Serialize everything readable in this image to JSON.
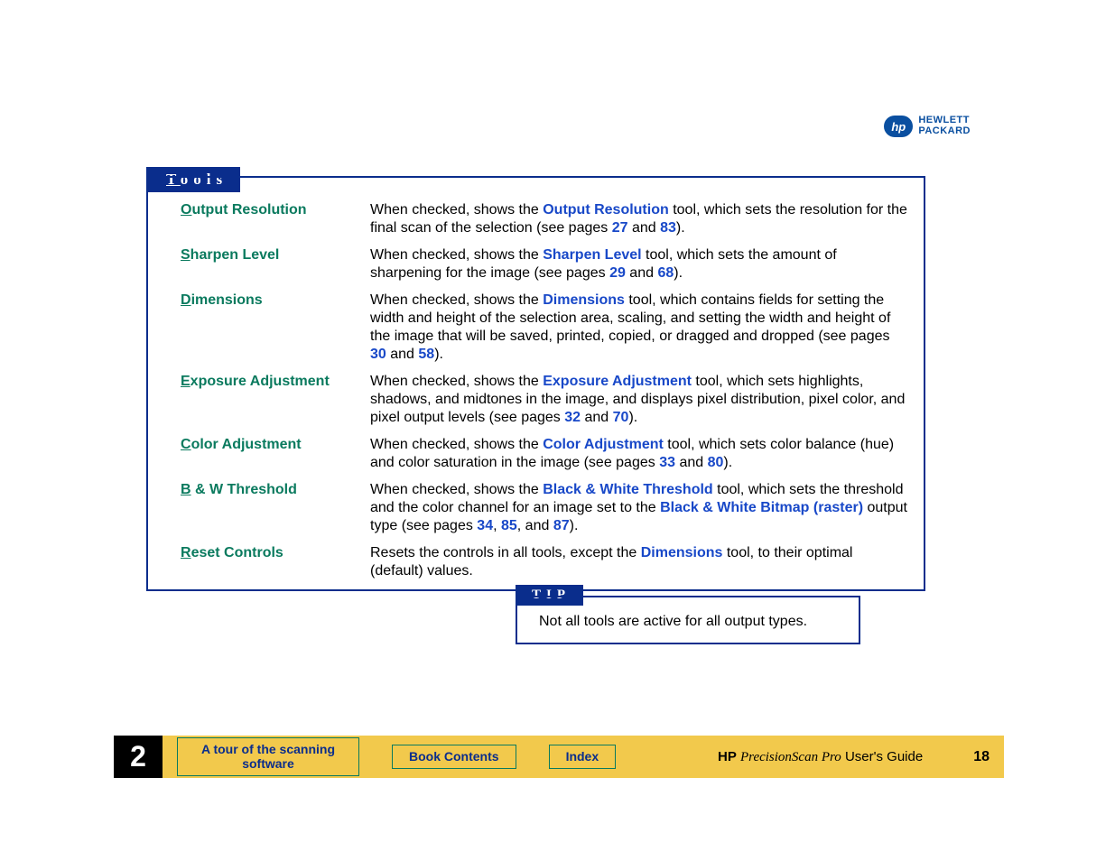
{
  "brand": {
    "line1": "HEWLETT",
    "line2": "PACKARD",
    "badge": "hp"
  },
  "toolsTab": {
    "accel": "T",
    "rest": "ools"
  },
  "rows": [
    {
      "label": {
        "accel": "O",
        "rest": "utput Resolution"
      },
      "d1": "When checked, shows the ",
      "l1": "Output Resolution",
      "d2": " tool, which sets the resolution for the final scan of the selection (see pages ",
      "p1": "27",
      "sep1": " and ",
      "p2": "83",
      "tail": ")."
    },
    {
      "label": {
        "accel": "S",
        "rest": "harpen Level"
      },
      "d1": "When checked, shows the ",
      "l1": "Sharpen Level",
      "d2": " tool, which sets the amount of sharpening for the image (see pages ",
      "p1": "29",
      "sep1": " and ",
      "p2": "68",
      "tail": ")."
    },
    {
      "label": {
        "accel": "D",
        "rest": "imensions"
      },
      "d1": "When checked, shows the ",
      "l1": "Dimensions",
      "d2": " tool, which contains fields for setting the width and height of the selection area, scaling, and setting the width and height of the image that will be saved, printed, copied, or dragged and dropped (see pages ",
      "p1": "30",
      "sep1": " and ",
      "p2": "58",
      "tail": ")."
    },
    {
      "label": {
        "accel": "E",
        "rest": "xposure Adjustment"
      },
      "d1": "When checked, shows the ",
      "l1": "Exposure Adjustment",
      "d2": " tool, which sets highlights, shadows, and midtones in the image, and displays pixel distribution, pixel color, and pixel output levels (see pages ",
      "p1": "32",
      "sep1": " and ",
      "p2": "70",
      "tail": ")."
    },
    {
      "label": {
        "accel": "C",
        "rest": "olor Adjustment"
      },
      "d1": "When checked, shows the ",
      "l1": "Color Adjustment",
      "d2": " tool, which sets color balance (hue) and color saturation in the image (see pages ",
      "p1": "33",
      "sep1": " and ",
      "p2": "80",
      "tail": ")."
    }
  ],
  "bwRow": {
    "label": {
      "accel": "B",
      "rest": " & W Threshold"
    },
    "d1": "When checked, shows the ",
    "l1": "Black & White Threshold",
    "d2": " tool, which sets the threshold and the color channel for an image set to the ",
    "l2": "Black & White Bitmap (raster)",
    "d3": " output type (see pages ",
    "p1": "34",
    "sep1": ", ",
    "p2": "85",
    "sep2": ", and ",
    "p3": "87",
    "tail": ")."
  },
  "resetRow": {
    "label": {
      "accel": "R",
      "rest": "eset Controls"
    },
    "d1": "Resets the controls in all tools, except the ",
    "l1": "Dimensions",
    "d2": " tool, to their optimal (default) values."
  },
  "tip": {
    "tab": "TIP",
    "text": "Not all tools are active for all output types."
  },
  "footer": {
    "chapter": "2",
    "tourBtn": "A tour of the scanning software",
    "contentsBtn": "Book Contents",
    "indexBtn": "Index",
    "hp": "HP",
    "space1": "  ",
    "product": "PrecisionScan Pro",
    "guideTail": " User's Guide",
    "page": "18"
  }
}
